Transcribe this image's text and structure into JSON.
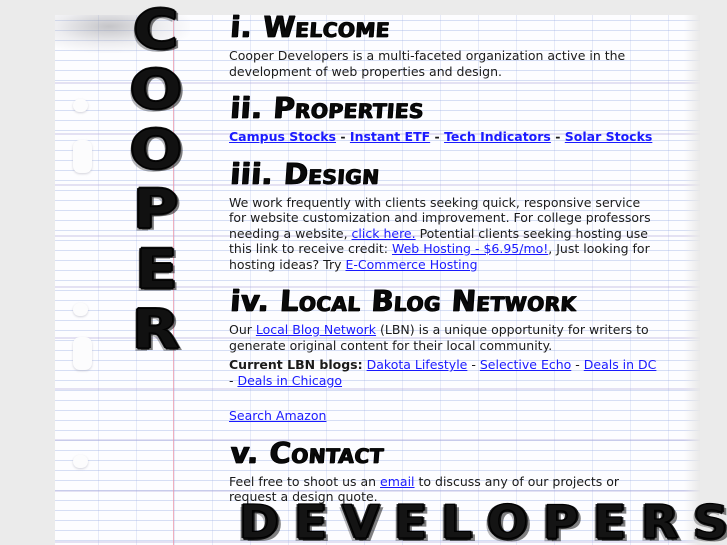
{
  "colors": {
    "page_background": "#ebebeb",
    "paper": "#fdfdff",
    "rule_line": "#96aae1",
    "margin_rule": "#eb96aa",
    "link": "#1a1aff",
    "text": "#1b1b1b",
    "ink": "#0a0a0a"
  },
  "sidebar": {
    "vertical_word": "COOPER",
    "letters": [
      "C",
      "O",
      "O",
      "P",
      "E",
      "R"
    ]
  },
  "footer_banner": {
    "word": "DEVELOPERS",
    "letters": [
      "D",
      "E",
      "V",
      "E",
      "L",
      "O",
      "P",
      "E",
      "R",
      "S"
    ]
  },
  "sections": {
    "welcome": {
      "number": "i.",
      "heading": "Welcome",
      "body": "Cooper Developers is a multi-faceted organization active in the development of web properties and design."
    },
    "properties": {
      "number": "ii.",
      "heading": "Properties",
      "links": [
        {
          "label": "Campus Stocks"
        },
        {
          "label": "Instant ETF"
        },
        {
          "label": "Tech Indicators"
        },
        {
          "label": "Solar Stocks"
        }
      ],
      "separator": "-"
    },
    "design": {
      "number": "iii.",
      "heading": "Design",
      "text_1": "We work frequently with clients seeking quick, responsive service for website customization and improvement. For college professors needing a website, ",
      "link_1": "click here.",
      "text_2": " Potential clients seeking hosting use this link to receive credit: ",
      "link_2": "Web Hosting - $6.95/mo!",
      "text_3": ", Just looking for hosting ideas? Try ",
      "link_3": "E-Commerce Hosting"
    },
    "local_blog_network": {
      "number": "iv.",
      "heading": "Local Blog Network",
      "text_1": "Our ",
      "link_1": "Local Blog Network",
      "text_2": " (LBN) is a unique opportunity for writers to generate original content for their local community.",
      "blogs_label": "Current LBN blogs:",
      "blog_links": [
        {
          "label": "Dakota Lifestyle"
        },
        {
          "label": "Selective Echo"
        },
        {
          "label": "Deals in DC"
        },
        {
          "label": "Deals in Chicago"
        }
      ],
      "separator": "-",
      "amazon_link": "Search Amazon"
    },
    "contact": {
      "number": "v.",
      "heading": "Contact",
      "text_1": "Feel free to shoot us an ",
      "link_1": "email",
      "text_2": " to discuss any of our projects or request a design quote."
    }
  }
}
